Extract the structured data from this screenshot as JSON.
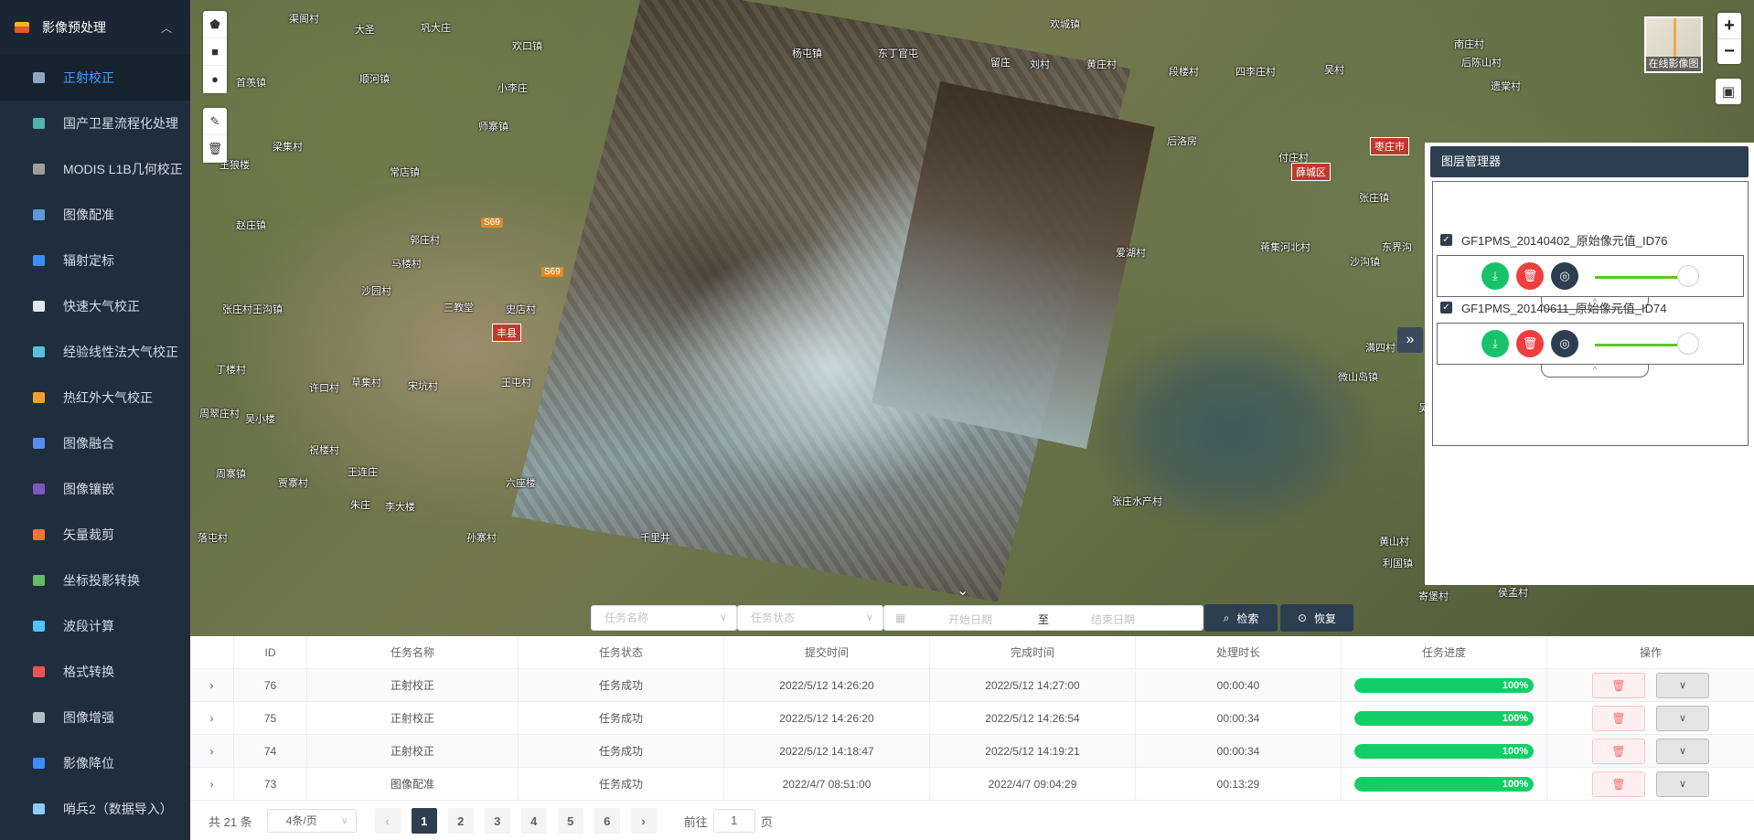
{
  "sidebar": {
    "group_label": "影像预处理",
    "items": [
      {
        "label": "正射校正",
        "active": true,
        "icon_color": "#8fa6c0"
      },
      {
        "label": "国产卫星流程化处理",
        "icon_color": "#4db6ac"
      },
      {
        "label": "MODIS L1B几何校正",
        "icon_color": "#9e9e9e"
      },
      {
        "label": "图像配准",
        "icon_color": "#5c9bd5"
      },
      {
        "label": "辐射定标",
        "icon_color": "#3d8bfd"
      },
      {
        "label": "快速大气校正",
        "icon_color": "#dfe6ee"
      },
      {
        "label": "经验线性法大气校正",
        "icon_color": "#5bc0de"
      },
      {
        "label": "热红外大气校正",
        "icon_color": "#f0a030"
      },
      {
        "label": "图像融合",
        "icon_color": "#5b8def"
      },
      {
        "label": "图像镶嵌",
        "icon_color": "#7e57c2"
      },
      {
        "label": "矢量裁剪",
        "icon_color": "#ff6f3c"
      },
      {
        "label": "坐标投影转换",
        "icon_color": "#66bb6a"
      },
      {
        "label": "波段计算",
        "icon_color": "#4fc3f7"
      },
      {
        "label": "格式转换",
        "icon_color": "#ef5350"
      },
      {
        "label": "图像增强",
        "icon_color": "#b0bec5"
      },
      {
        "label": "影像降位",
        "icon_color": "#3d8bfd"
      },
      {
        "label": "哨兵2（数据导入）",
        "icon_color": "#90caf9"
      }
    ]
  },
  "map": {
    "labels": [
      {
        "t": "渠阁村"
      },
      {
        "t": "大圣"
      },
      {
        "t": "巩大庄"
      },
      {
        "t": "欢口镇"
      },
      {
        "t": "首羡镇"
      },
      {
        "t": "顺河镇"
      },
      {
        "t": "小李庄"
      },
      {
        "t": "师寨镇"
      },
      {
        "t": "梁集村"
      },
      {
        "t": "王狼楼"
      },
      {
        "t": "常店镇"
      },
      {
        "t": "赵庄镇"
      },
      {
        "t": "郭庄村"
      },
      {
        "t": "马楼村"
      },
      {
        "t": "沙园村"
      },
      {
        "t": "三教堂"
      },
      {
        "t": "张庄村"
      },
      {
        "t": "王沟镇"
      },
      {
        "t": "史店村"
      },
      {
        "t": "丁楼村"
      },
      {
        "t": "许口村"
      },
      {
        "t": "草集村"
      },
      {
        "t": "宋坑村"
      },
      {
        "t": "王屯村"
      },
      {
        "t": "周翠庄村"
      },
      {
        "t": "吴小楼"
      },
      {
        "t": "祝楼村"
      },
      {
        "t": "周寨镇"
      },
      {
        "t": "贾寨村"
      },
      {
        "t": "王连庄"
      },
      {
        "t": "六座楼"
      },
      {
        "t": "朱庄"
      },
      {
        "t": "李大楼"
      },
      {
        "t": "落屯村"
      },
      {
        "t": "孙寨村"
      },
      {
        "t": "千里井"
      },
      {
        "t": "杨屯镇"
      },
      {
        "t": "东丁官屯"
      },
      {
        "t": "欢城镇"
      },
      {
        "t": "黄庄村"
      },
      {
        "t": "段楼村"
      },
      {
        "t": "四李庄村"
      },
      {
        "t": "吴村"
      },
      {
        "t": "后陈山村"
      },
      {
        "t": "南庄村"
      },
      {
        "t": "遗棠村"
      },
      {
        "t": "后洛房"
      },
      {
        "t": "付庄村"
      },
      {
        "t": "张庄镇"
      },
      {
        "t": "东界沟"
      },
      {
        "t": "蒋集河北村"
      },
      {
        "t": "沙沟镇"
      },
      {
        "t": "爱湖村"
      },
      {
        "t": "满四村"
      },
      {
        "t": "微山岛镇"
      },
      {
        "t": "吴家村"
      },
      {
        "t": "张庄水产村"
      },
      {
        "t": "黄山村"
      },
      {
        "t": "利国镇"
      },
      {
        "t": "侯孟村"
      },
      {
        "t": "寄堡村"
      },
      {
        "t": "留庄"
      },
      {
        "t": "刘村"
      }
    ],
    "city_tags": [
      {
        "t": "枣庄市"
      },
      {
        "t": "薛城区"
      },
      {
        "t": "丰县"
      }
    ],
    "road_tags": [
      {
        "t": "S69"
      },
      {
        "t": "S69"
      }
    ],
    "basemap_label": "在线影像图"
  },
  "draw_tools": [
    {
      "glyph": "⬟",
      "name": "polygon-tool-icon"
    },
    {
      "glyph": "■",
      "name": "rectangle-tool-icon"
    },
    {
      "glyph": "●",
      "name": "circle-tool-icon"
    }
  ],
  "edit_tools": [
    {
      "glyph": "✎",
      "name": "edit-tool-icon"
    },
    {
      "glyph": "🗑",
      "name": "trash-tool-icon"
    }
  ],
  "zoom": {
    "in": "+",
    "out": "−"
  },
  "layer_panel": {
    "title": "图层管理器",
    "layers": [
      {
        "name": "GF1PMS_20140402_原始像元值_ID76",
        "opacity": 1.0
      },
      {
        "name": "GF1PMS_20140611_原始像元值_ID74",
        "opacity": 1.0
      }
    ]
  },
  "search": {
    "task_name_placeholder": "任务名称",
    "task_status_placeholder": "任务状态",
    "start_date_placeholder": "开始日期",
    "date_sep": "至",
    "end_date_placeholder": "结束日期",
    "search_label": "检索",
    "reset_label": "恢复"
  },
  "table": {
    "headers": [
      "ID",
      "任务名称",
      "任务状态",
      "提交时间",
      "完成时间",
      "处理时长",
      "任务进度",
      "操作"
    ],
    "rows": [
      {
        "id": "76",
        "name": "正射校正",
        "status": "任务成功",
        "submit": "2022/5/12 14:26:20",
        "finish": "2022/5/12 14:27:00",
        "duration": "00:00:40",
        "progress": 100,
        "progress_label": "100%"
      },
      {
        "id": "75",
        "name": "正射校正",
        "status": "任务成功",
        "submit": "2022/5/12 14:26:20",
        "finish": "2022/5/12 14:26:54",
        "duration": "00:00:34",
        "progress": 100,
        "progress_label": "100%"
      },
      {
        "id": "74",
        "name": "正射校正",
        "status": "任务成功",
        "submit": "2022/5/12 14:18:47",
        "finish": "2022/5/12 14:19:21",
        "duration": "00:00:34",
        "progress": 100,
        "progress_label": "100%"
      },
      {
        "id": "73",
        "name": "图像配准",
        "status": "任务成功",
        "submit": "2022/4/7 08:51:00",
        "finish": "2022/4/7 09:04:29",
        "duration": "00:13:29",
        "progress": 100,
        "progress_label": "100%"
      }
    ]
  },
  "pagination": {
    "total": "共 21 条",
    "page_size": "4条/页",
    "pages": [
      "1",
      "2",
      "3",
      "4",
      "5",
      "6"
    ],
    "current": "1",
    "goto_prefix": "前往",
    "goto_value": "1",
    "goto_suffix": "页"
  },
  "colors": {
    "accent": "#409eff",
    "dark": "#2d3e50",
    "success": "#13ce66",
    "danger": "#f56c6c"
  }
}
